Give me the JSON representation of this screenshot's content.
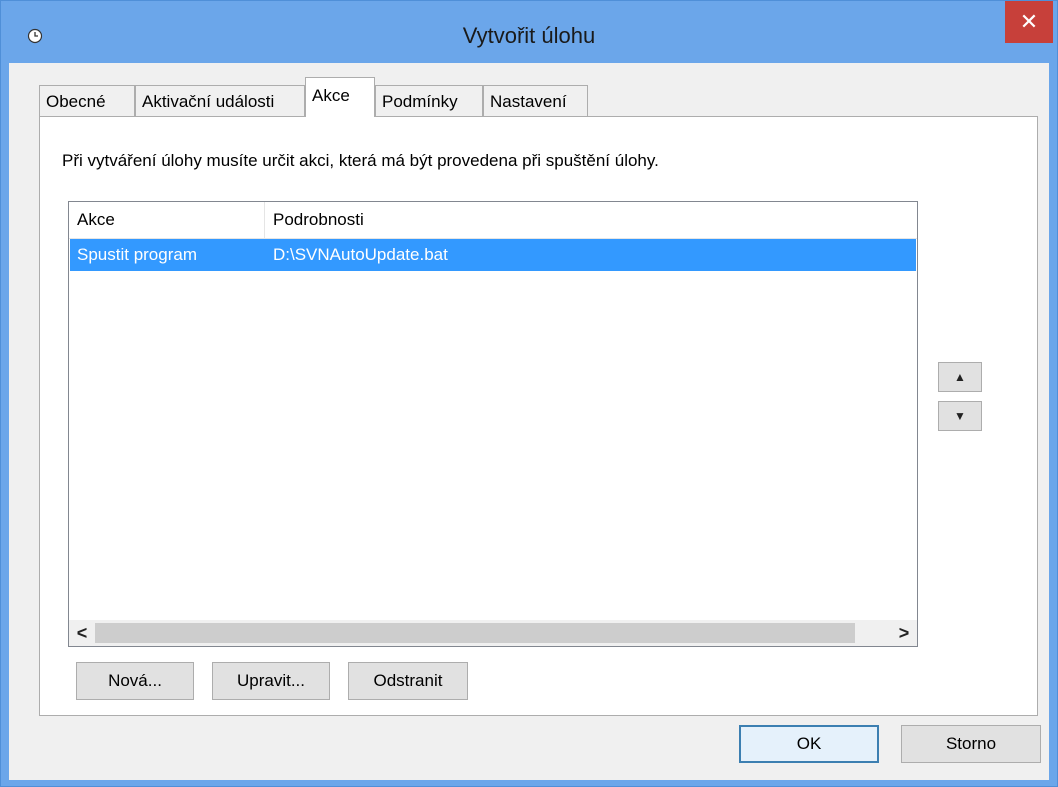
{
  "window": {
    "title": "Vytvořit úlohu",
    "close_label": "✕",
    "icon": "clock-icon"
  },
  "tabs": [
    {
      "label": "Obecné",
      "active": false
    },
    {
      "label": "Aktivační události",
      "active": false
    },
    {
      "label": "Akce",
      "active": true
    },
    {
      "label": "Podmínky",
      "active": false
    },
    {
      "label": "Nastavení",
      "active": false
    }
  ],
  "panel": {
    "description": "Při vytváření úlohy musíte určit akci, která má být provedena při spuštění úlohy."
  },
  "list": {
    "columns": [
      "Akce",
      "Podrobnosti"
    ],
    "rows": [
      {
        "action": "Spustit program",
        "details": "D:\\SVNAutoUpdate.bat",
        "selected": true
      }
    ],
    "scroll_left": "<",
    "scroll_right": ">"
  },
  "order_buttons": {
    "up": "▲",
    "down": "▼"
  },
  "list_buttons": {
    "new": "Nová...",
    "edit": "Upravit...",
    "delete": "Odstranit"
  },
  "dialog_buttons": {
    "ok": "OK",
    "cancel": "Storno"
  },
  "colors": {
    "titlebar": "#6ba6ea",
    "close": "#c7403a",
    "selection": "#3399ff"
  }
}
